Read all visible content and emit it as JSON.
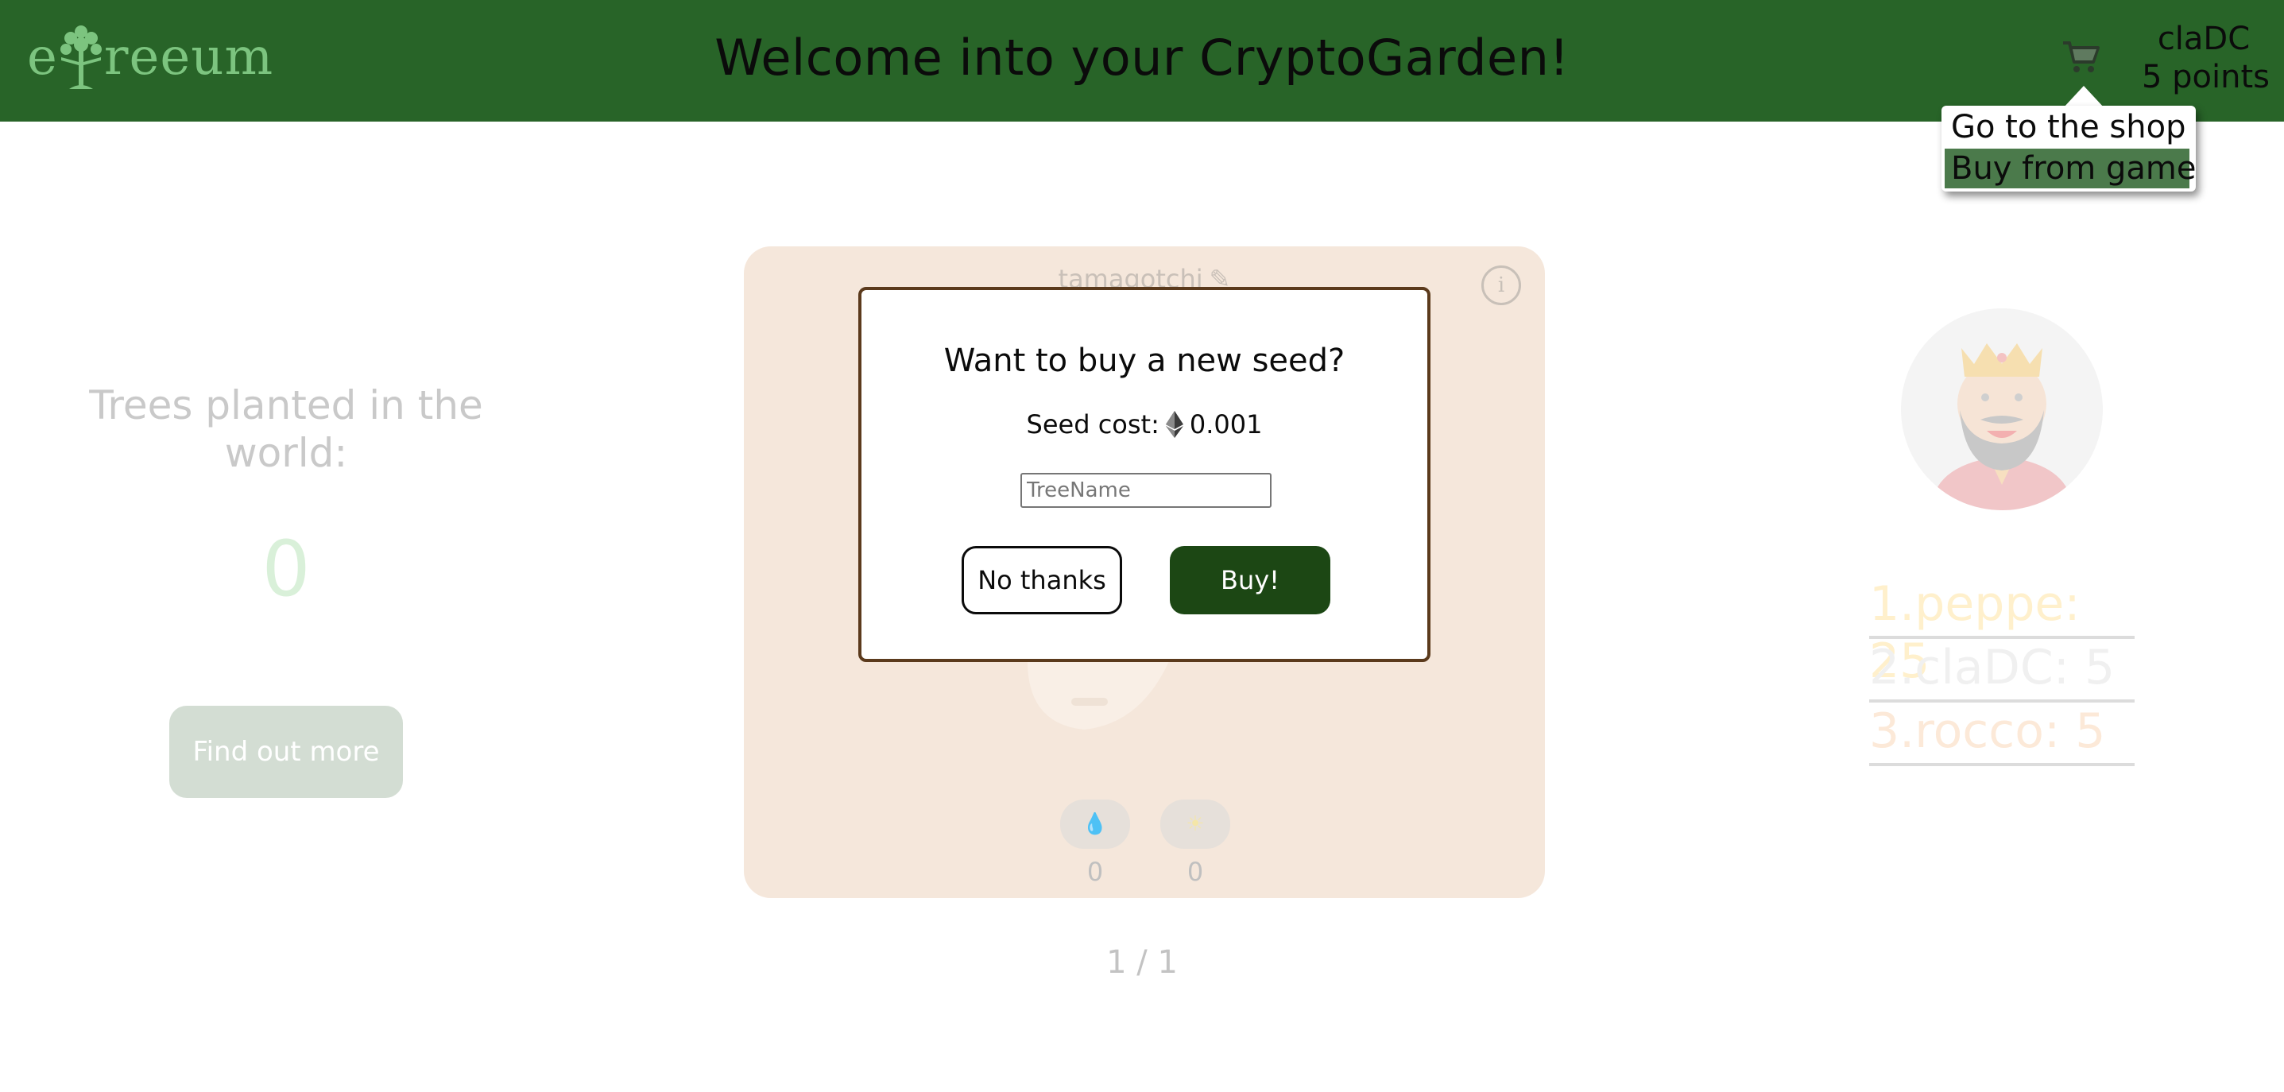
{
  "header": {
    "logo_left": "e",
    "logo_right": "reeum",
    "title": "Welcome into your CryptoGarden!",
    "cart_icon": "cart-icon",
    "user_name": "claDC",
    "user_points": "5 points"
  },
  "cart_menu": {
    "items": [
      "Go to the shop",
      "Buy from game"
    ],
    "selected": "Buy from game"
  },
  "left_panel": {
    "label": "Trees planted in the world:",
    "count": "0",
    "button": "Find out more"
  },
  "tree_card": {
    "name": "tamagotchi",
    "edit_icon": "pencil-icon",
    "info_icon": "info-icon",
    "water_icon": "water-drop-icon",
    "sun_icon": "sun-icon",
    "water_value": "0",
    "sun_value": "0",
    "pager": "1 / 1"
  },
  "leaderboard": {
    "avatar_icon": "king-avatar-icon",
    "entries": [
      "1.peppe: 25",
      "2.claDC: 5",
      "3.rocco: 5"
    ]
  },
  "modal": {
    "title": "Want to buy a new seed?",
    "cost_label": "Seed cost:",
    "cost_icon": "ethereum-icon",
    "cost_value": "0.001",
    "input_placeholder": "TreeName",
    "cancel_label": "No thanks",
    "buy_label": "Buy!"
  },
  "colors": {
    "header_bg": "#286428",
    "logo": "#7cc47f",
    "card_bg": "#f5e7db",
    "buy_button": "#1c4714",
    "modal_border": "#5b3a1c",
    "menu_highlight": "#4b7a4b"
  }
}
